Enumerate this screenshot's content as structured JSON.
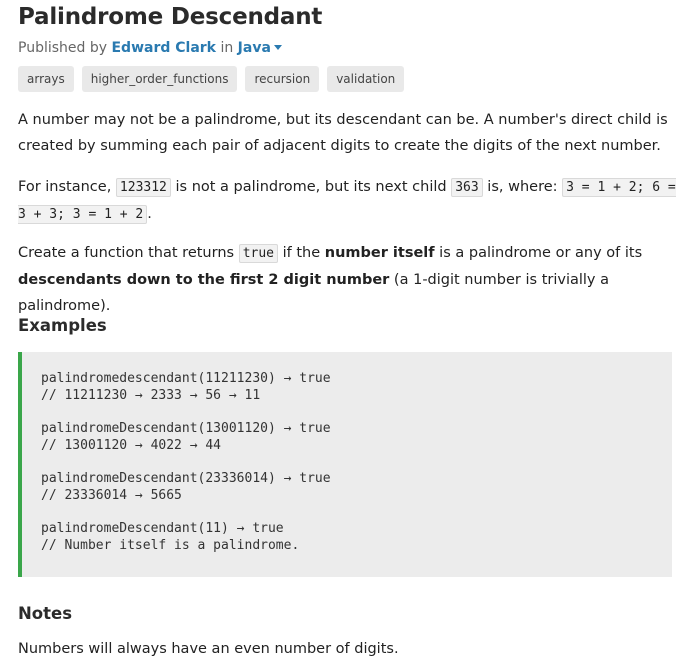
{
  "challenge": {
    "title": "Palindrome Descendant",
    "byline": {
      "prefix": "Published by ",
      "author": "Edward Clark",
      "middle": " in ",
      "language": "Java"
    },
    "tags": [
      "arrays",
      "higher_order_functions",
      "recursion",
      "validation"
    ]
  },
  "description": {
    "p1": "A number may not be a palindrome, but its descendant can be. A number's direct child is created by summing each pair of adjacent digits to create the digits of the next number.",
    "p2": {
      "t1": "For instance, ",
      "c1": "123312",
      "t2": " is not a palindrome, but its next child ",
      "c2": "363",
      "t3": " is, where: ",
      "c3": "3 = 1 + 2; 6 = 3 + 3; 3 = 1 + 2",
      "t4": "."
    },
    "p3": {
      "t1": "Create a function that returns ",
      "c1": "true",
      "t2": " if the ",
      "b1": "number itself",
      "t3": " is a palindrome or any of its ",
      "b2": "descendants down to the first 2 digit number",
      "t4": " (a 1-digit number is trivially a palindrome)."
    }
  },
  "examples": {
    "heading": "Examples",
    "lines": [
      "palindromedescendant(11211230) → true",
      "// 11211230 → 2333 → 56 → 11",
      "",
      "palindromeDescendant(13001120) → true",
      "// 13001120 → 4022 → 44",
      "",
      "palindromeDescendant(23336014) → true",
      "// 23336014 → 5665",
      "",
      "palindromeDescendant(11) → true",
      "// Number itself is a palindrome."
    ]
  },
  "notes": {
    "heading": "Notes",
    "text": "Numbers will always have an even number of digits."
  },
  "colors": {
    "link": "#2a7ab0",
    "code_accent": "#3aa64a",
    "tag_bg": "#e9e9e9",
    "code_bg": "#ececec"
  }
}
